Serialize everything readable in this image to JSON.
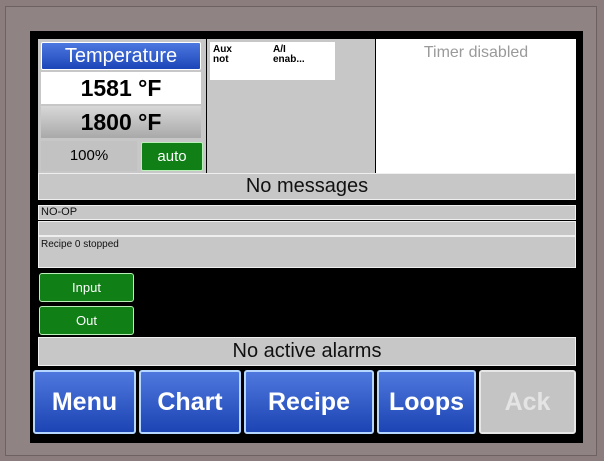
{
  "loop": {
    "name": "Temperature",
    "process_value": "1581 °F",
    "setpoint": "1800 °F",
    "output_percent": "100%",
    "mode": "auto"
  },
  "aux": {
    "col1_header": "Aux",
    "col2_header": "A/I",
    "col1_value": "not",
    "col2_value": "enab..."
  },
  "timer": {
    "status": "Timer disabled"
  },
  "messages": {
    "main": "No messages",
    "line1": "NO-OP",
    "line2": "",
    "line3": "Recipe 0 stopped"
  },
  "io": {
    "input_label": "Input",
    "output_label": "Out"
  },
  "alarms": {
    "status": "No active alarms"
  },
  "nav": {
    "menu": "Menu",
    "chart": "Chart",
    "recipe": "Recipe",
    "loops": "Loops",
    "ack": "Ack"
  },
  "colors": {
    "button_blue": "#1c44b3",
    "button_green": "#0f7f16",
    "panel_gray": "#c7c7c7",
    "screen_black": "#000000"
  }
}
